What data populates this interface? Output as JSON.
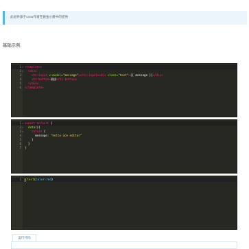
{
  "notice": "此组件源于view作者在掘金小册中的提供",
  "section_title": "基础示例",
  "editors": [
    {
      "lines": [
        [
          [
            "t",
            "<template>"
          ]
        ],
        [
          [
            "w",
            "  "
          ],
          [
            "t",
            "<div>"
          ]
        ],
        [
          [
            "w",
            "    "
          ],
          [
            "t",
            "<tc-input "
          ],
          [
            "a",
            "v-model="
          ],
          [
            "s",
            "\"message\""
          ],
          [
            "t",
            "></tc-input>"
          ],
          [
            "t",
            "<div "
          ],
          [
            "a",
            "class="
          ],
          [
            "s",
            "\"test\""
          ],
          [
            "t",
            ">"
          ],
          [
            "w",
            "{{ message }}"
          ],
          [
            "t",
            "</div>"
          ]
        ],
        [
          [
            "w",
            "    "
          ],
          [
            "t",
            "<tc-button>"
          ],
          [
            "w",
            "测试"
          ],
          [
            "t",
            "</tc-button>"
          ]
        ],
        [
          [
            "w",
            "  "
          ],
          [
            "t",
            "</div>"
          ]
        ],
        [
          [
            "t",
            "</template>"
          ]
        ]
      ]
    },
    {
      "lines": [
        [
          [
            "k",
            "export default "
          ],
          [
            "w",
            "{"
          ]
        ],
        [
          [
            "w",
            "  "
          ],
          [
            "n",
            "data"
          ],
          [
            "w",
            "(){"
          ]
        ],
        [
          [
            "w",
            "    "
          ],
          [
            "k",
            "return "
          ],
          [
            "w",
            "{"
          ]
        ],
        [
          [
            "w",
            "      message: "
          ],
          [
            "s",
            "\"hello ace editor\""
          ]
        ],
        [
          [
            "w",
            "    }"
          ]
        ],
        [
          [
            "w",
            "  }"
          ]
        ],
        [
          [
            "w",
            "}"
          ]
        ]
      ]
    },
    {
      "lines": [
        [
          [
            "a",
            ".test"
          ],
          [
            "w",
            "{"
          ],
          [
            "c",
            "color"
          ],
          [
            "w",
            ":"
          ],
          [
            "c",
            "red"
          ],
          [
            "w",
            "}"
          ]
        ]
      ]
    }
  ],
  "run_button": "运行代码"
}
